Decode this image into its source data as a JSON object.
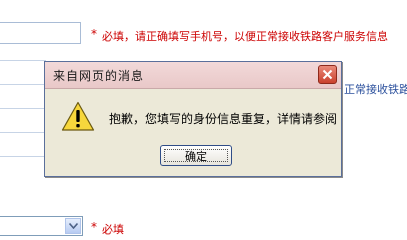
{
  "form": {
    "phone_required_mark": "*",
    "phone_note": "必填，请正确填写手机号，以便正常接收铁路客户服务信息",
    "second_note": "正常接收铁路客",
    "select_required_mark": "*",
    "select_required_text": "必填",
    "select_value": ""
  },
  "dialog": {
    "title": "来自网页的消息",
    "message": "抱歉，您填写的身份信息重复，详情请参阅",
    "ok_label": "确定",
    "close_icon": "close-icon",
    "warning_icon": "warning-icon"
  },
  "colors": {
    "required": "#cc0000",
    "note_blue": "#2a4f9c",
    "dialog_title_bg": "#f0d4d4",
    "dialog_body_bg": "#ece9d8"
  }
}
